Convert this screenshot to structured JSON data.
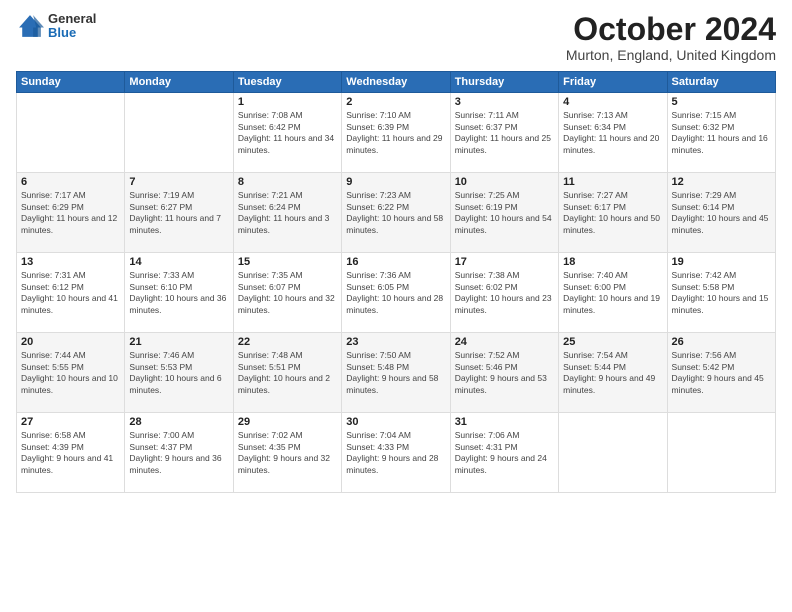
{
  "logo": {
    "general": "General",
    "blue": "Blue"
  },
  "title": "October 2024",
  "location": "Murton, England, United Kingdom",
  "days_of_week": [
    "Sunday",
    "Monday",
    "Tuesday",
    "Wednesday",
    "Thursday",
    "Friday",
    "Saturday"
  ],
  "weeks": [
    [
      {
        "day": "",
        "sunrise": "",
        "sunset": "",
        "daylight": ""
      },
      {
        "day": "",
        "sunrise": "",
        "sunset": "",
        "daylight": ""
      },
      {
        "day": "1",
        "sunrise": "Sunrise: 7:08 AM",
        "sunset": "Sunset: 6:42 PM",
        "daylight": "Daylight: 11 hours and 34 minutes."
      },
      {
        "day": "2",
        "sunrise": "Sunrise: 7:10 AM",
        "sunset": "Sunset: 6:39 PM",
        "daylight": "Daylight: 11 hours and 29 minutes."
      },
      {
        "day": "3",
        "sunrise": "Sunrise: 7:11 AM",
        "sunset": "Sunset: 6:37 PM",
        "daylight": "Daylight: 11 hours and 25 minutes."
      },
      {
        "day": "4",
        "sunrise": "Sunrise: 7:13 AM",
        "sunset": "Sunset: 6:34 PM",
        "daylight": "Daylight: 11 hours and 20 minutes."
      },
      {
        "day": "5",
        "sunrise": "Sunrise: 7:15 AM",
        "sunset": "Sunset: 6:32 PM",
        "daylight": "Daylight: 11 hours and 16 minutes."
      }
    ],
    [
      {
        "day": "6",
        "sunrise": "Sunrise: 7:17 AM",
        "sunset": "Sunset: 6:29 PM",
        "daylight": "Daylight: 11 hours and 12 minutes."
      },
      {
        "day": "7",
        "sunrise": "Sunrise: 7:19 AM",
        "sunset": "Sunset: 6:27 PM",
        "daylight": "Daylight: 11 hours and 7 minutes."
      },
      {
        "day": "8",
        "sunrise": "Sunrise: 7:21 AM",
        "sunset": "Sunset: 6:24 PM",
        "daylight": "Daylight: 11 hours and 3 minutes."
      },
      {
        "day": "9",
        "sunrise": "Sunrise: 7:23 AM",
        "sunset": "Sunset: 6:22 PM",
        "daylight": "Daylight: 10 hours and 58 minutes."
      },
      {
        "day": "10",
        "sunrise": "Sunrise: 7:25 AM",
        "sunset": "Sunset: 6:19 PM",
        "daylight": "Daylight: 10 hours and 54 minutes."
      },
      {
        "day": "11",
        "sunrise": "Sunrise: 7:27 AM",
        "sunset": "Sunset: 6:17 PM",
        "daylight": "Daylight: 10 hours and 50 minutes."
      },
      {
        "day": "12",
        "sunrise": "Sunrise: 7:29 AM",
        "sunset": "Sunset: 6:14 PM",
        "daylight": "Daylight: 10 hours and 45 minutes."
      }
    ],
    [
      {
        "day": "13",
        "sunrise": "Sunrise: 7:31 AM",
        "sunset": "Sunset: 6:12 PM",
        "daylight": "Daylight: 10 hours and 41 minutes."
      },
      {
        "day": "14",
        "sunrise": "Sunrise: 7:33 AM",
        "sunset": "Sunset: 6:10 PM",
        "daylight": "Daylight: 10 hours and 36 minutes."
      },
      {
        "day": "15",
        "sunrise": "Sunrise: 7:35 AM",
        "sunset": "Sunset: 6:07 PM",
        "daylight": "Daylight: 10 hours and 32 minutes."
      },
      {
        "day": "16",
        "sunrise": "Sunrise: 7:36 AM",
        "sunset": "Sunset: 6:05 PM",
        "daylight": "Daylight: 10 hours and 28 minutes."
      },
      {
        "day": "17",
        "sunrise": "Sunrise: 7:38 AM",
        "sunset": "Sunset: 6:02 PM",
        "daylight": "Daylight: 10 hours and 23 minutes."
      },
      {
        "day": "18",
        "sunrise": "Sunrise: 7:40 AM",
        "sunset": "Sunset: 6:00 PM",
        "daylight": "Daylight: 10 hours and 19 minutes."
      },
      {
        "day": "19",
        "sunrise": "Sunrise: 7:42 AM",
        "sunset": "Sunset: 5:58 PM",
        "daylight": "Daylight: 10 hours and 15 minutes."
      }
    ],
    [
      {
        "day": "20",
        "sunrise": "Sunrise: 7:44 AM",
        "sunset": "Sunset: 5:55 PM",
        "daylight": "Daylight: 10 hours and 10 minutes."
      },
      {
        "day": "21",
        "sunrise": "Sunrise: 7:46 AM",
        "sunset": "Sunset: 5:53 PM",
        "daylight": "Daylight: 10 hours and 6 minutes."
      },
      {
        "day": "22",
        "sunrise": "Sunrise: 7:48 AM",
        "sunset": "Sunset: 5:51 PM",
        "daylight": "Daylight: 10 hours and 2 minutes."
      },
      {
        "day": "23",
        "sunrise": "Sunrise: 7:50 AM",
        "sunset": "Sunset: 5:48 PM",
        "daylight": "Daylight: 9 hours and 58 minutes."
      },
      {
        "day": "24",
        "sunrise": "Sunrise: 7:52 AM",
        "sunset": "Sunset: 5:46 PM",
        "daylight": "Daylight: 9 hours and 53 minutes."
      },
      {
        "day": "25",
        "sunrise": "Sunrise: 7:54 AM",
        "sunset": "Sunset: 5:44 PM",
        "daylight": "Daylight: 9 hours and 49 minutes."
      },
      {
        "day": "26",
        "sunrise": "Sunrise: 7:56 AM",
        "sunset": "Sunset: 5:42 PM",
        "daylight": "Daylight: 9 hours and 45 minutes."
      }
    ],
    [
      {
        "day": "27",
        "sunrise": "Sunrise: 6:58 AM",
        "sunset": "Sunset: 4:39 PM",
        "daylight": "Daylight: 9 hours and 41 minutes."
      },
      {
        "day": "28",
        "sunrise": "Sunrise: 7:00 AM",
        "sunset": "Sunset: 4:37 PM",
        "daylight": "Daylight: 9 hours and 36 minutes."
      },
      {
        "day": "29",
        "sunrise": "Sunrise: 7:02 AM",
        "sunset": "Sunset: 4:35 PM",
        "daylight": "Daylight: 9 hours and 32 minutes."
      },
      {
        "day": "30",
        "sunrise": "Sunrise: 7:04 AM",
        "sunset": "Sunset: 4:33 PM",
        "daylight": "Daylight: 9 hours and 28 minutes."
      },
      {
        "day": "31",
        "sunrise": "Sunrise: 7:06 AM",
        "sunset": "Sunset: 4:31 PM",
        "daylight": "Daylight: 9 hours and 24 minutes."
      },
      {
        "day": "",
        "sunrise": "",
        "sunset": "",
        "daylight": ""
      },
      {
        "day": "",
        "sunrise": "",
        "sunset": "",
        "daylight": ""
      }
    ]
  ]
}
